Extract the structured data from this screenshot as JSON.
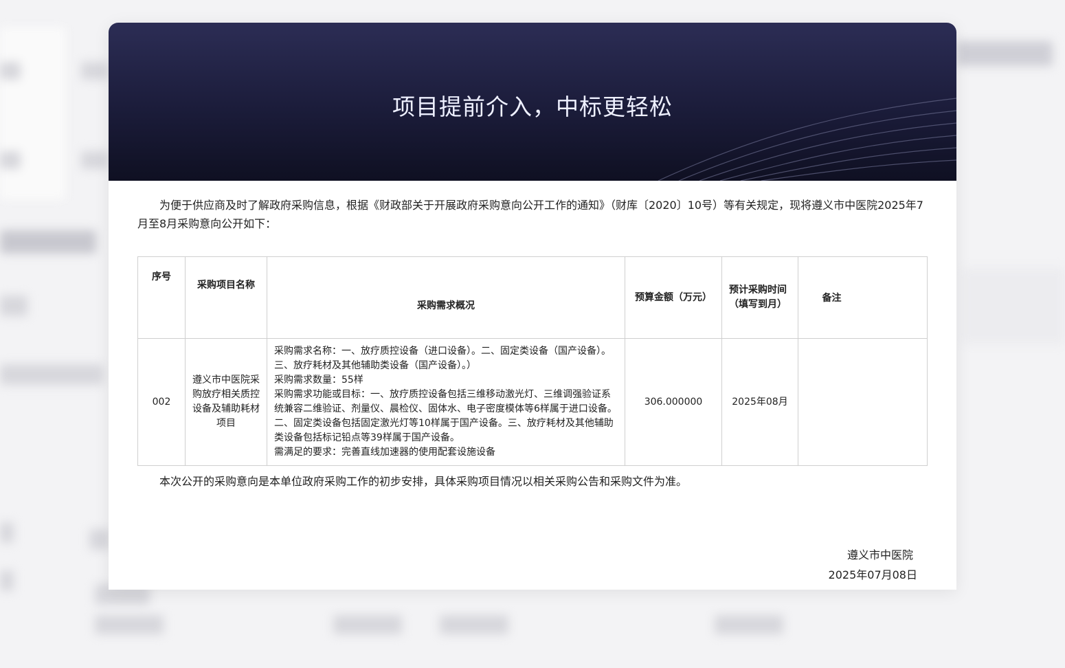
{
  "banner": {
    "title": "项目提前介入，中标更轻松"
  },
  "intro": "为便于供应商及时了解政府采购信息，根据《财政部关于开展政府采购意向公开工作的通知》（财库〔2020〕10号）等有关规定，现将遵义市中医院2025年7月至8月采购意向公开如下：",
  "table": {
    "headers": {
      "no": "序号",
      "name": "采购项目名称",
      "desc": "采购需求概况",
      "budget": "预算金额（万元）",
      "time": "预计采购时间（填写到月）",
      "remark": "备注"
    },
    "rows": [
      {
        "no": "002",
        "name": "遵义市中医院采购放疗相关质控设备及辅助耗材项目",
        "desc_name": "采购需求名称：一、放疗质控设备（进口设备）。二、固定类设备（国产设备）。三、放疗耗材及其他辅助类设备（国产设备）。）",
        "desc_qty": "采购需求数量：55样",
        "desc_goal": "采购需求功能或目标：一、放疗质控设备包括三维移动激光灯、三维调强验证系统兼容二维验证、剂量仪、晨检仪、固体水、电子密度模体等6样属于进口设备。二、固定类设备包括固定激光灯等10样属于国产设备。三、放疗耗材及其他辅助类设备包括标记铅点等39样属于国产设备。",
        "desc_req": "需满足的要求：完善直线加速器的使用配套设施设备",
        "budget": "306.000000",
        "time": "2025年08月",
        "remark": ""
      }
    ]
  },
  "note": "本次公开的采购意向是本单位政府采购工作的初步安排，具体采购项目情况以相关采购公告和采购文件为准。",
  "signature": {
    "org": "遵义市中医院",
    "date": "2025年07月08日"
  }
}
